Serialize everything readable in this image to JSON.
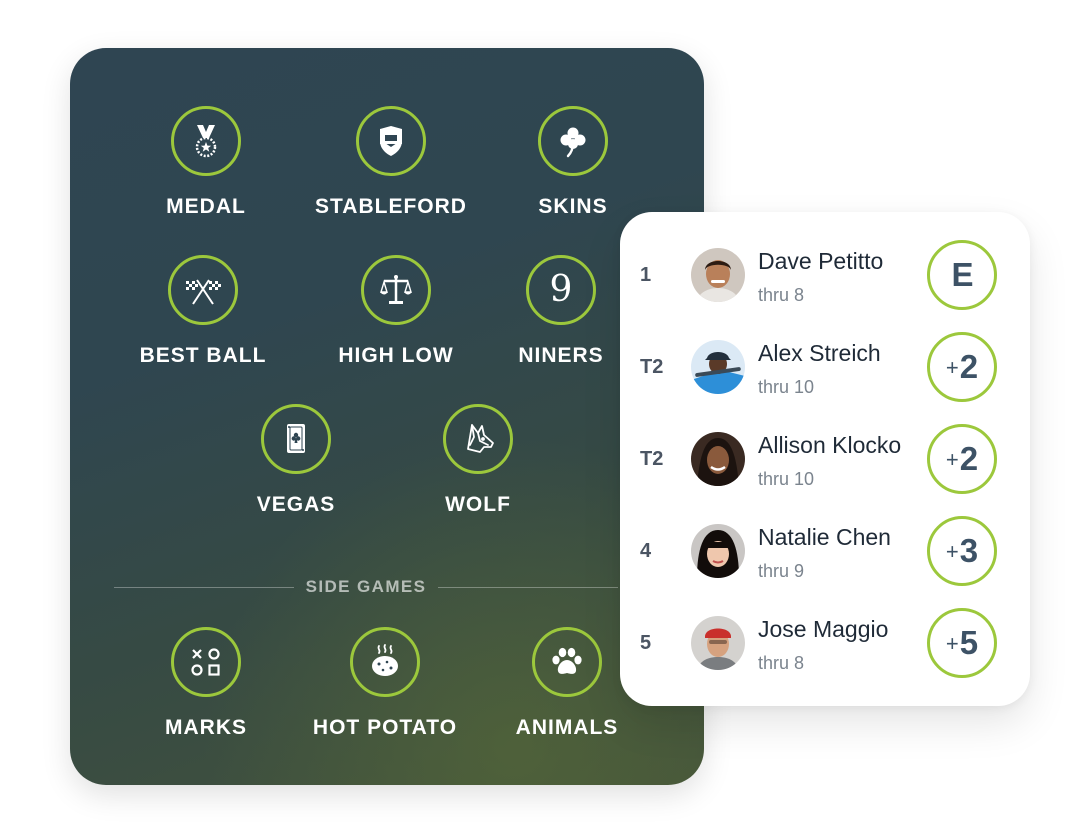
{
  "games": [
    {
      "id": "medal",
      "label": "MEDAL",
      "icon": "medal-icon"
    },
    {
      "id": "stableford",
      "label": "STABLEFORD",
      "icon": "shield-icon"
    },
    {
      "id": "skins",
      "label": "SKINS",
      "icon": "clover-icon"
    },
    {
      "id": "best-ball",
      "label": "BEST BALL",
      "icon": "crossed-flags-icon"
    },
    {
      "id": "high-low",
      "label": "HIGH LOW",
      "icon": "scales-icon"
    },
    {
      "id": "niners",
      "label": "NINERS",
      "icon": "nine-icon",
      "glyph": "9"
    },
    {
      "id": "vegas",
      "label": "VEGAS",
      "icon": "playing-card-icon"
    },
    {
      "id": "wolf",
      "label": "WOLF",
      "icon": "wolf-icon"
    }
  ],
  "side_games_label": "SIDE GAMES",
  "side_games": [
    {
      "id": "marks",
      "label": "MARKS",
      "icon": "shapes-icon"
    },
    {
      "id": "hot-potato",
      "label": "HOT POTATO",
      "icon": "hot-potato-icon"
    },
    {
      "id": "animals",
      "label": "ANIMALS",
      "icon": "paw-icon"
    }
  ],
  "leaderboard": [
    {
      "position": "1",
      "name": "Dave Petitto",
      "thru": "thru 8",
      "score_prefix": "",
      "score": "E",
      "avatar": "avatar-dave"
    },
    {
      "position": "T2",
      "name": "Alex Streich",
      "thru": "thru 10",
      "score_prefix": "+",
      "score": "2",
      "avatar": "avatar-alex"
    },
    {
      "position": "T2",
      "name": "Allison Klocko",
      "thru": "thru 10",
      "score_prefix": "+",
      "score": "2",
      "avatar": "avatar-allison"
    },
    {
      "position": "4",
      "name": "Natalie Chen",
      "thru": "thru 9",
      "score_prefix": "+",
      "score": "3",
      "avatar": "avatar-natalie"
    },
    {
      "position": "5",
      "name": "Jose Maggio",
      "thru": "thru 8",
      "score_prefix": "+",
      "score": "5",
      "avatar": "avatar-jose"
    }
  ],
  "colors": {
    "accent": "#9cc83c",
    "panel_dark": "#2f4552",
    "score_text": "#3d5266"
  }
}
